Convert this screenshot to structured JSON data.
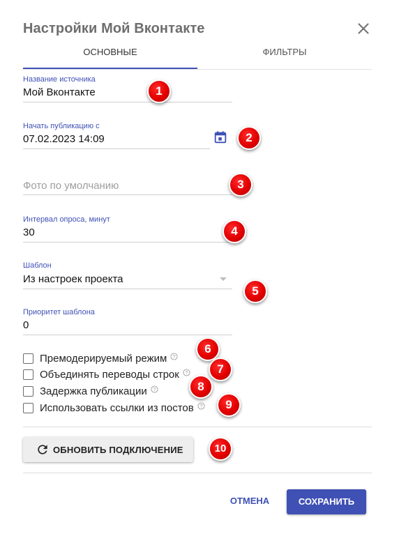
{
  "dialog": {
    "title": "Настройки Мой Вконтакте",
    "close_icon": "close-icon"
  },
  "tabs": [
    {
      "label": "ОСНОВНЫЕ",
      "active": true
    },
    {
      "label": "ФИЛЬТРЫ",
      "active": false
    }
  ],
  "fields": {
    "source_name": {
      "label": "Название источника",
      "value": "Мой Вконтакте"
    },
    "start_publication": {
      "label": "Начать публикацию с",
      "value": "07.02.2023 14:09",
      "icon": "calendar-icon"
    },
    "default_photo": {
      "placeholder": "Фото по умолчанию"
    },
    "poll_interval": {
      "label": "Интервал опроса, минут",
      "value": "30"
    },
    "template": {
      "label": "Шаблон",
      "value": "Из настроек проекта"
    },
    "template_priority": {
      "label": "Приоритет шаблона",
      "value": "0"
    }
  },
  "checkboxes": [
    {
      "label": "Премодерируемый режим",
      "checked": false
    },
    {
      "label": "Объединять переводы строк",
      "checked": false
    },
    {
      "label": "Задержка публикации",
      "checked": false
    },
    {
      "label": "Использовать ссылки из постов",
      "checked": false
    }
  ],
  "buttons": {
    "refresh_label": "ОБНОВИТЬ ПОДКЛЮЧЕНИЕ",
    "refresh_icon": "refresh-icon",
    "cancel_label": "ОТМЕНА",
    "save_label": "СОХРАНИТЬ"
  },
  "markers": [
    "1",
    "2",
    "3",
    "4",
    "5",
    "6",
    "7",
    "8",
    "9",
    "10"
  ],
  "colors": {
    "accent": "#3f51b5",
    "marker": "#e20000"
  }
}
